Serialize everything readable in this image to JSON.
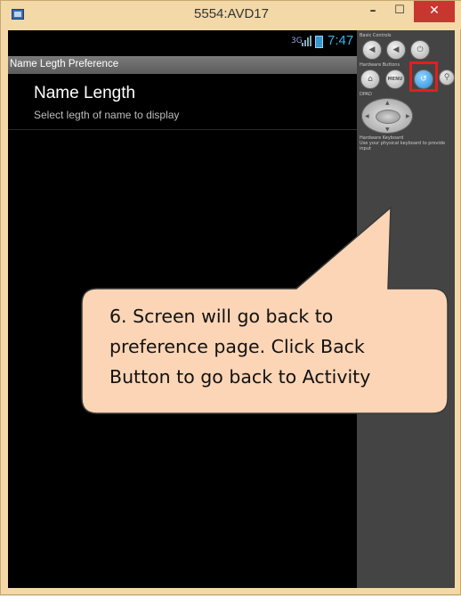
{
  "window": {
    "title": "5554:AVD17",
    "minimize_glyph": "–",
    "maximize_glyph": "☐",
    "close_glyph": "✕"
  },
  "status_bar": {
    "network": "3G",
    "time": "7:47"
  },
  "action_bar": {
    "title": "Name Legth Preference"
  },
  "preference": {
    "title": "Name Length",
    "summary": "Select legth of name to display"
  },
  "controls": {
    "basic_label": "Basic Controls",
    "hardware_label": "Hardware Buttons",
    "dpad_label": "DPAD",
    "keyboard_label": "Hardware Keyboard",
    "keyboard_hint": "Use your physical keyboard to provide input",
    "menu_label": "MENU"
  },
  "callout": {
    "line1": "6. Screen will go back to",
    "line2": "preference page. Click Back",
    "line3": "Button to go back to Activity"
  },
  "colors": {
    "callout_fill": "#fbd5b5",
    "callout_stroke": "#3a3a3a",
    "highlight": "#e31e1e",
    "clock": "#33b5e5"
  }
}
